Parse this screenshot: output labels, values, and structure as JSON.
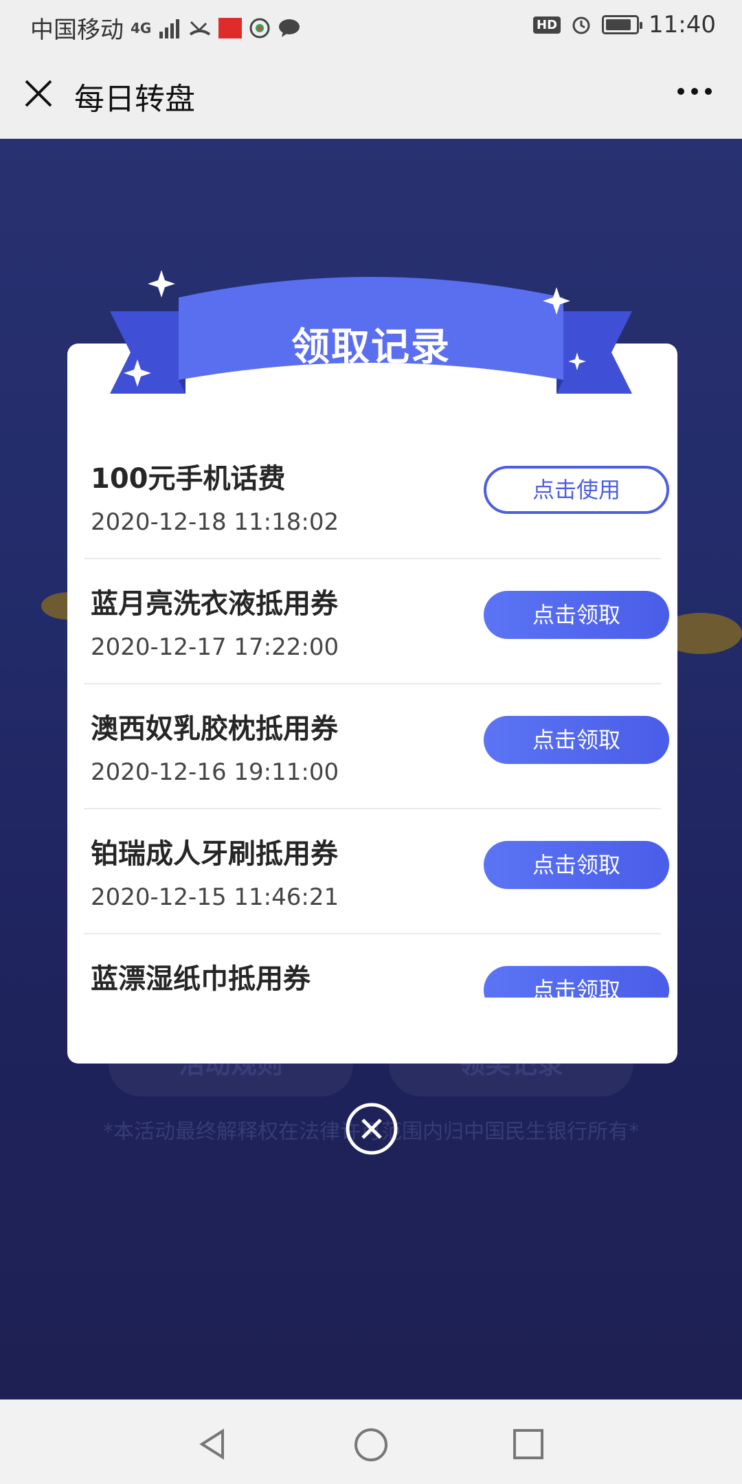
{
  "status_bar": {
    "carrier": "中国移动",
    "network": "4G",
    "hd": "HD",
    "battery_level": 0.85,
    "time": "11:40"
  },
  "titlebar": {
    "title": "每日转盘"
  },
  "background_page": {
    "rules_button": "活动规则",
    "records_button": "领奖记录",
    "footnote": "*本活动最终解释权在法律许可范围内归中国民生银行所有*"
  },
  "modal": {
    "title": "领取记录",
    "records": [
      {
        "name": "100元手机话费",
        "time": "2020-12-18 11:18:02",
        "action": "点击使用",
        "style": "outline"
      },
      {
        "name": "蓝月亮洗衣液抵用券",
        "time": "2020-12-17 17:22:00",
        "action": "点击领取",
        "style": "filled"
      },
      {
        "name": "澳西奴乳胶枕抵用券",
        "time": "2020-12-16 19:11:00",
        "action": "点击领取",
        "style": "filled"
      },
      {
        "name": "铂瑞成人牙刷抵用券",
        "time": "2020-12-15 11:46:21",
        "action": "点击领取",
        "style": "filled"
      },
      {
        "name": "蓝漂湿纸巾抵用券",
        "time": "",
        "action": "点击领取",
        "style": "filled"
      }
    ]
  },
  "colors": {
    "accent": "#4d5fe0",
    "ribbon": "#5a6ef0",
    "ribbon_dark": "#3f4fd6"
  },
  "icons": {
    "close": "close-icon",
    "more": "more-icon",
    "dismiss": "close-circle-icon",
    "nav_back": "back-triangle-icon",
    "nav_home": "home-circle-icon",
    "nav_recent": "recent-square-icon"
  }
}
